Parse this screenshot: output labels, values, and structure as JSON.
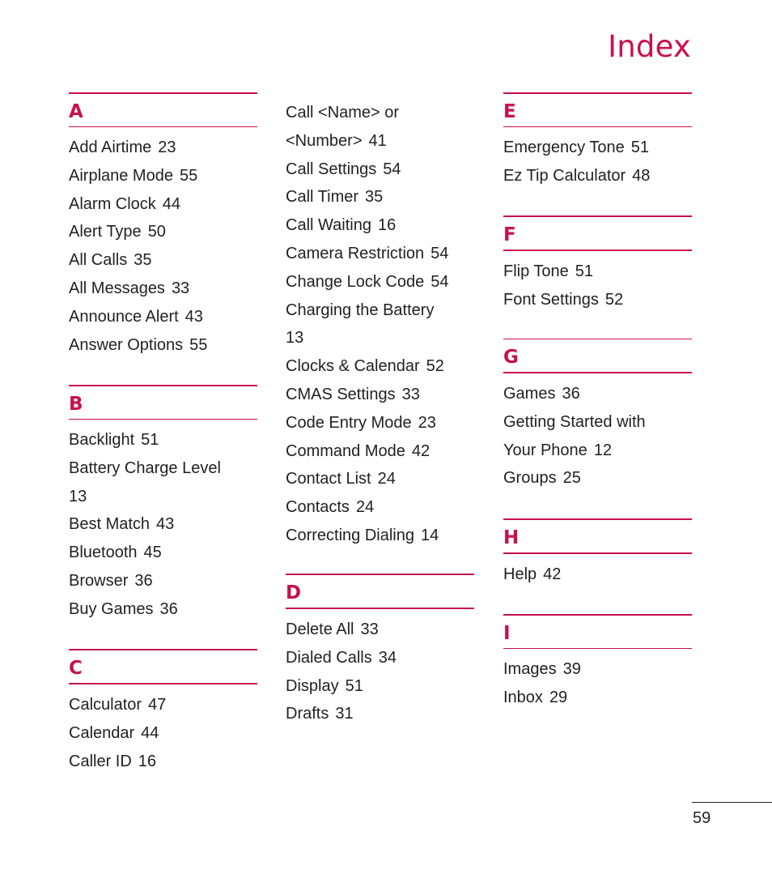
{
  "page_title": "Index",
  "page_number": "59",
  "accent_color": "#c8104f",
  "sections": {
    "A": {
      "letter": "A",
      "entries": [
        {
          "term": "Add Airtime",
          "page": "23"
        },
        {
          "term": "Airplane Mode",
          "page": "55"
        },
        {
          "term": "Alarm Clock",
          "page": "44"
        },
        {
          "term": "Alert Type",
          "page": "50"
        },
        {
          "term": "All Calls",
          "page": "35"
        },
        {
          "term": "All Messages",
          "page": "33"
        },
        {
          "term": "Announce Alert",
          "page": "43"
        },
        {
          "term": "Answer Options",
          "page": "55"
        }
      ]
    },
    "B": {
      "letter": "B",
      "entries": [
        {
          "term": "Backlight",
          "page": "51"
        },
        {
          "term": "Battery Charge Level",
          "page": "13"
        },
        {
          "term": "Best Match",
          "page": "43"
        },
        {
          "term": "Bluetooth",
          "page": "45"
        },
        {
          "term": "Browser",
          "page": "36"
        },
        {
          "term": "Buy Games",
          "page": "36"
        }
      ]
    },
    "C": {
      "letter": "C",
      "entries": [
        {
          "term": "Calculator",
          "page": "47"
        },
        {
          "term": "Calendar",
          "page": "44"
        },
        {
          "term": "Caller ID",
          "page": "16"
        },
        {
          "term": "Call <Name> or <Number>",
          "page": "41"
        },
        {
          "term": "Call Settings",
          "page": "54"
        },
        {
          "term": "Call Timer",
          "page": "35"
        },
        {
          "term": "Call Waiting",
          "page": "16"
        },
        {
          "term": "Camera Restriction",
          "page": "54"
        },
        {
          "term": "Change Lock Code",
          "page": "54"
        },
        {
          "term": "Charging the Battery",
          "page": "13"
        },
        {
          "term": "Clocks & Calendar",
          "page": "52"
        },
        {
          "term": "CMAS Settings",
          "page": "33"
        },
        {
          "term": "Code Entry Mode",
          "page": "23"
        },
        {
          "term": "Command Mode",
          "page": "42"
        },
        {
          "term": "Contact List",
          "page": "24"
        },
        {
          "term": "Contacts",
          "page": "24"
        },
        {
          "term": "Correcting Dialing",
          "page": "14"
        }
      ]
    },
    "D": {
      "letter": "D",
      "entries": [
        {
          "term": "Delete All",
          "page": "33"
        },
        {
          "term": "Dialed Calls",
          "page": "34"
        },
        {
          "term": "Display",
          "page": "51"
        },
        {
          "term": "Drafts",
          "page": "31"
        }
      ]
    },
    "E": {
      "letter": "E",
      "entries": [
        {
          "term": "Emergency Tone",
          "page": "51"
        },
        {
          "term": "Ez Tip Calculator",
          "page": "48"
        }
      ]
    },
    "F": {
      "letter": "F",
      "entries": [
        {
          "term": "Flip Tone",
          "page": "51"
        },
        {
          "term": "Font Settings",
          "page": "52"
        }
      ]
    },
    "G": {
      "letter": "G",
      "entries": [
        {
          "term": "Games",
          "page": "36"
        },
        {
          "term": "Getting Started with Your Phone",
          "page": "12"
        },
        {
          "term": "Groups",
          "page": "25"
        }
      ]
    },
    "H": {
      "letter": "H",
      "entries": [
        {
          "term": "Help",
          "page": "42"
        }
      ]
    },
    "I": {
      "letter": "I",
      "entries": [
        {
          "term": "Images",
          "page": "39"
        },
        {
          "term": "Inbox",
          "page": "29"
        }
      ]
    }
  },
  "wrapped_lines": {
    "B1_line1": "Battery Charge Level",
    "C3_line1": "Call <Name> or",
    "C3_line2": "<Number>",
    "C9_line1": "Charging the Battery",
    "G1_line1": "Getting Started with",
    "G1_line2": "Your Phone"
  }
}
